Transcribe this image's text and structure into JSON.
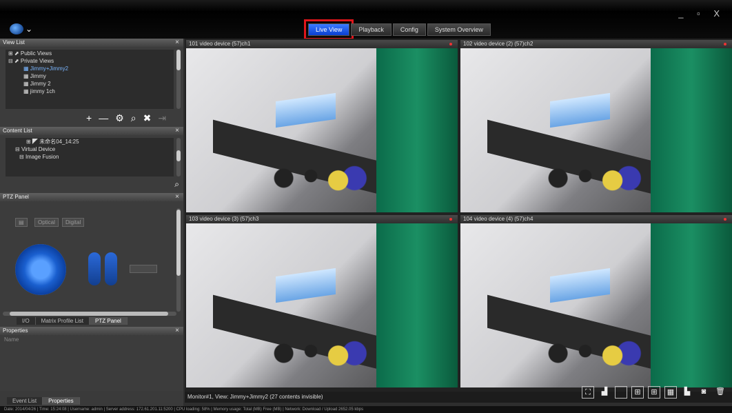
{
  "window": {
    "controls": "_ ▫ X"
  },
  "tabs": [
    {
      "label": "Live View",
      "active": true
    },
    {
      "label": "Playback"
    },
    {
      "label": "Config"
    },
    {
      "label": "System Overview"
    }
  ],
  "view_list": {
    "title": "View List",
    "items": [
      {
        "label": "Public Views"
      },
      {
        "label": "Private Views"
      },
      {
        "label": "Jimmy+Jimmy2",
        "selected": true
      },
      {
        "label": "Jimmy"
      },
      {
        "label": "Jimmy 2"
      },
      {
        "label": "jimmy 1ch"
      }
    ],
    "tools": [
      "+",
      "—",
      "⚙",
      "⌕",
      "✖",
      "⇥"
    ]
  },
  "content_list": {
    "title": "Content List",
    "items": [
      {
        "label": "未命名04_14:25"
      },
      {
        "label": "Virtual Device"
      },
      {
        "label": "Image Fusion"
      }
    ]
  },
  "ptz": {
    "title": "PTZ Panel",
    "chips": [
      "Optical",
      "Digital"
    ],
    "bottom_tabs": [
      "I/O",
      "Matrix Profile List",
      "PTZ Panel"
    ]
  },
  "properties": {
    "title": "Properties",
    "field": "Name"
  },
  "left_footer_tabs": [
    "Event List",
    "Properties"
  ],
  "cells": [
    {
      "title": "101 video device (57)ch1"
    },
    {
      "title": "102 video device (2) (57)ch2"
    },
    {
      "title": "103 video device (3) (57)ch3"
    },
    {
      "title": "104 video device (4) (57)ch4"
    }
  ],
  "status": {
    "text": "Monitor#1, View: Jimmy+Jimmy2 (27 contents invisible)"
  },
  "footer": {
    "text": "Date: 2014/04/26 | Time: 15:24:08 | Username: admin | Server address: 172.61.201.11:5200 | CPU loading: 58% | Memory usage: Total (MB) Free (MB) | Network: Download / Upload 2652.05 kbps"
  }
}
